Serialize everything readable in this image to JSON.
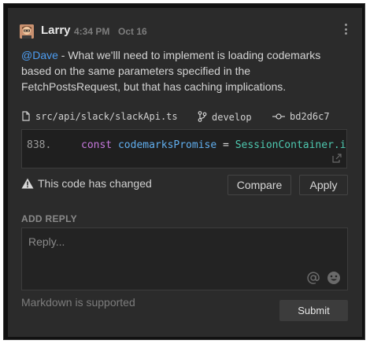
{
  "comment": {
    "author": "Larry",
    "time": "4:34 PM",
    "date": "Oct 16",
    "mention": "@Dave",
    "message_rest": " - What we'lll need to implement is loading codemarks based on the same parameters specified in the FetchPostsRequest, but that has caching implications."
  },
  "code_ref": {
    "file": "src/api/slack/slackApi.ts",
    "branch": "develop",
    "commit": "bd2d6c7",
    "line_number": "838.",
    "code_keyword": "const",
    "code_var": "codemarksPromise",
    "code_op": " = ",
    "code_class": "SessionContainer.i"
  },
  "status": {
    "warning": "This code has changed"
  },
  "buttons": {
    "compare": "Compare",
    "apply": "Apply",
    "submit": "Submit"
  },
  "reply": {
    "heading": "ADD REPLY",
    "placeholder": "Reply...",
    "markdown_note": "Markdown is supported"
  },
  "icons": {
    "kebab": "more-icon",
    "file": "file-icon",
    "branch": "branch-icon",
    "commit": "commit-icon",
    "warning": "warning-icon",
    "open": "open-external-icon",
    "mention": "at-icon",
    "emoji": "emoji-icon"
  },
  "colors": {
    "mention": "#4d9ef3",
    "keyword": "#c678dd",
    "variable": "#61afef",
    "class": "#4ec9b0"
  }
}
